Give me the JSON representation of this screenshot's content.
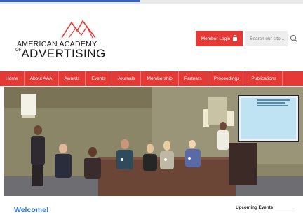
{
  "logo": {
    "line1": "AMERICAN ACADEMY",
    "line2_prefix": "OF",
    "line2": "ADVERTISING"
  },
  "header": {
    "login_label": "Member Login",
    "search_placeholder": "Search our site..."
  },
  "nav": {
    "items": [
      "Home",
      "About AAA",
      "Awards",
      "Events",
      "Journals",
      "Membership",
      "Partners",
      "Proceedings",
      "Publications"
    ]
  },
  "main": {
    "welcome_heading": "Welcome!"
  },
  "sidebar": {
    "upcoming_heading": "Upcoming Events"
  },
  "colors": {
    "brand_red": "#e53935",
    "heading_blue": "#2e7bd6"
  },
  "icons": {
    "login": "lock-icon",
    "search": "search-icon"
  }
}
